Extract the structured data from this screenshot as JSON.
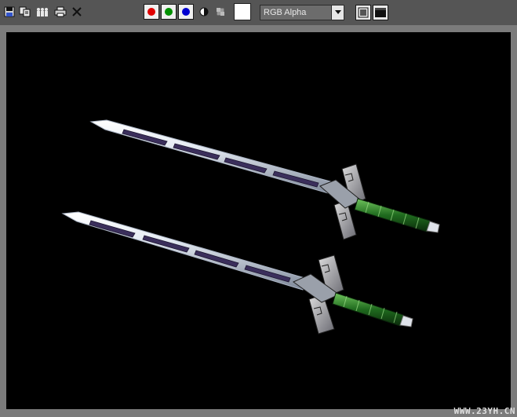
{
  "toolbar": {
    "icons": [
      "save-icon",
      "copy-icon",
      "clone-icon",
      "print-icon",
      "clear-icon"
    ],
    "channels": {
      "red_color": "#e00000",
      "green_color": "#009000",
      "blue_color": "#0000d0"
    },
    "swatch_color": "#ffffff",
    "display_mode": "RGB Alpha"
  },
  "viewport": {
    "background": "#000000",
    "content": "two-swords-render"
  },
  "watermark": "WWW.23YH.CN"
}
